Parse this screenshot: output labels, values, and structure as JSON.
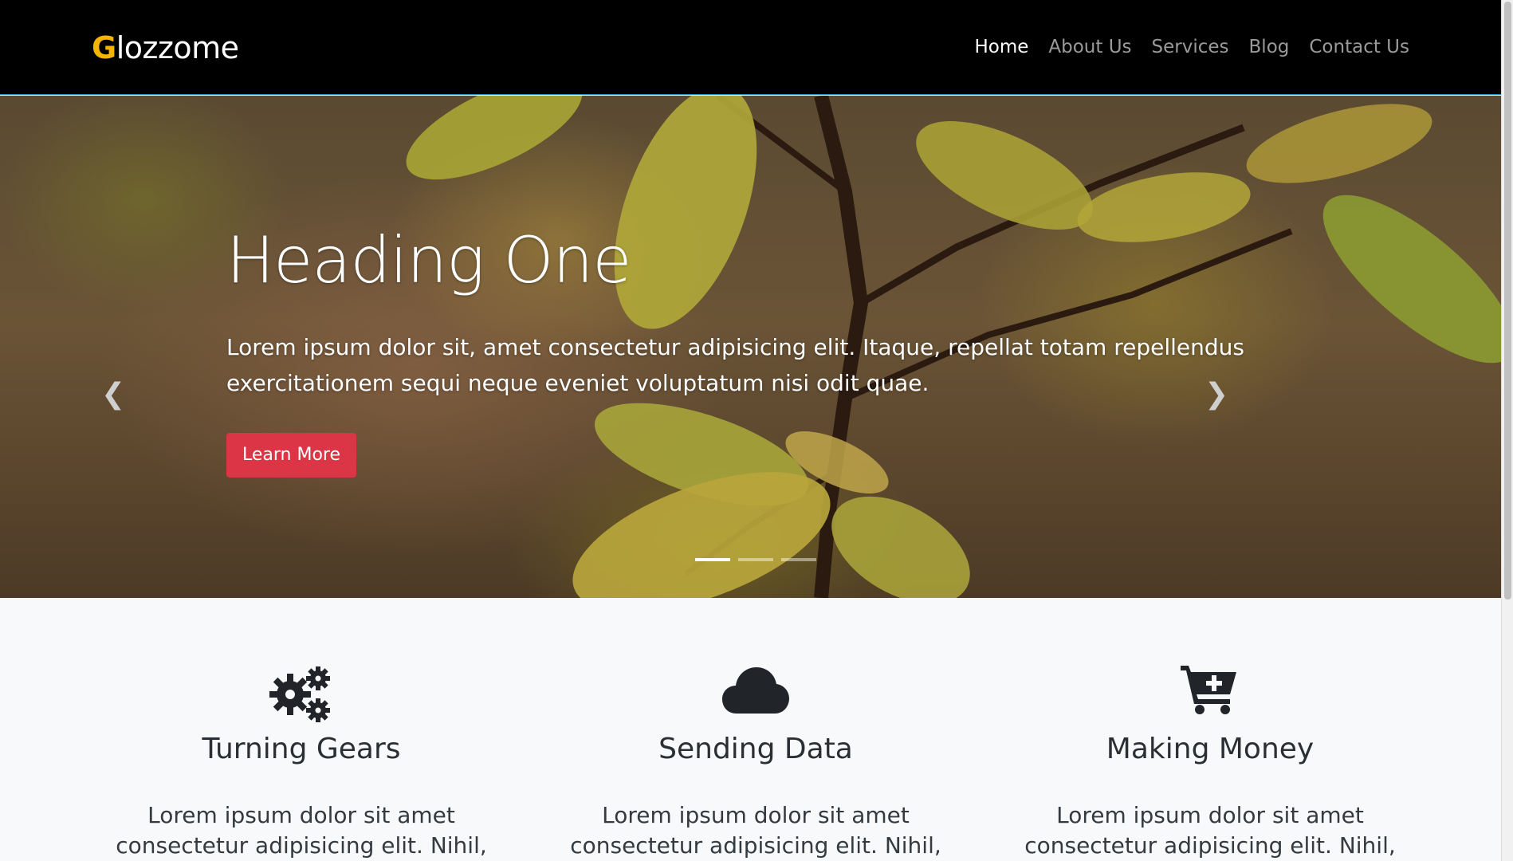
{
  "brand": {
    "first_letter": "G",
    "rest": "lozzome",
    "accent_color": "#f5b400"
  },
  "nav": {
    "items": [
      {
        "label": "Home",
        "active": true
      },
      {
        "label": "About Us",
        "active": false
      },
      {
        "label": "Services",
        "active": false
      },
      {
        "label": "Blog",
        "active": false
      },
      {
        "label": "Contact Us",
        "active": false
      }
    ]
  },
  "hero": {
    "heading": "Heading One",
    "text": "Lorem ipsum dolor sit, amet consectetur adipisicing elit. Itaque, repellat totam repellendus exercitationem sequi neque eveniet voluptatum nisi odit quae.",
    "button_label": "Learn More",
    "button_color": "#dc3545",
    "prev_icon": "chevron-left-icon",
    "next_icon": "chevron-right-icon",
    "slide_count": 3,
    "active_slide": 1
  },
  "features": [
    {
      "icon": "gears-icon",
      "title": "Turning Gears",
      "text": "Lorem ipsum dolor sit amet consectetur adipisicing elit. Nihil, unde ad. Amet"
    },
    {
      "icon": "cloud-icon",
      "title": "Sending Data",
      "text": "Lorem ipsum dolor sit amet consectetur adipisicing elit. Nihil, unde ad. Amet"
    },
    {
      "icon": "cart-plus-icon",
      "title": "Making Money",
      "text": "Lorem ipsum dolor sit amet consectetur adipisicing elit. Nihil, unde ad. Amet"
    }
  ]
}
